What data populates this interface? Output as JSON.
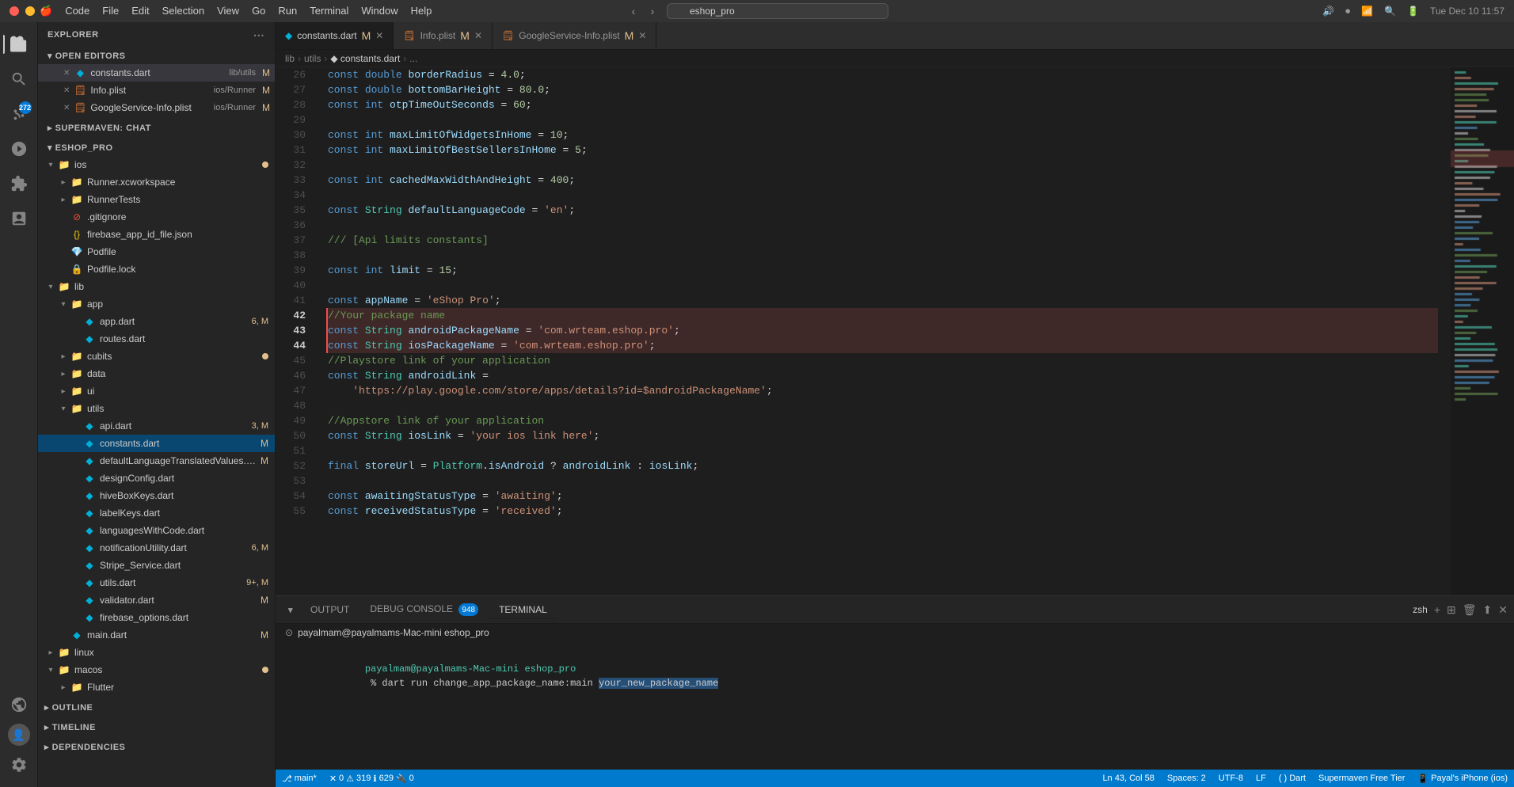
{
  "titlebar": {
    "menu_items": [
      "Code",
      "File",
      "Edit",
      "Selection",
      "View",
      "Go",
      "Run",
      "Terminal",
      "Window",
      "Help"
    ],
    "search_placeholder": "eshop_pro",
    "search_value": "eshop_pro",
    "time": "Tue Dec 10  11:57"
  },
  "tabs": [
    {
      "name": "constants.dart",
      "path": "lib/utils",
      "modified": true,
      "active": true
    },
    {
      "name": "Info.plist",
      "path": "ios/Runner",
      "modified": true,
      "active": false
    },
    {
      "name": "GoogleService-Info.plist",
      "path": "ios/Runner",
      "modified": true,
      "active": false
    }
  ],
  "breadcrumb": [
    "lib",
    ">",
    "utils",
    ">",
    "constants.dart",
    ">",
    "..."
  ],
  "sidebar": {
    "sections": [
      {
        "id": "open-editors",
        "label": "OPEN EDITORS",
        "items": [
          {
            "icon": "dart",
            "name": "constants.dart",
            "path": "lib/utils",
            "modified": true,
            "active": true,
            "level": 1
          },
          {
            "icon": "plist",
            "name": "Info.plist",
            "path": "ios/Runner",
            "modified": true,
            "level": 1
          },
          {
            "icon": "plist",
            "name": "GoogleService-Info.plist",
            "path": "ios/Runner",
            "modified": true,
            "level": 1
          }
        ]
      },
      {
        "id": "supermaven-chat",
        "label": "SUPERMAVEN: CHAT",
        "collapsed": true,
        "items": []
      },
      {
        "id": "eshop-pro",
        "label": "ESHOP_PRO",
        "items": [
          {
            "icon": "folder",
            "name": "ios",
            "level": 0,
            "expanded": true,
            "dot": true
          },
          {
            "icon": "folder",
            "name": "Runner.xcworkspace",
            "level": 1,
            "expanded": false
          },
          {
            "icon": "folder",
            "name": "RunnerTests",
            "level": 1,
            "expanded": false
          },
          {
            "icon": "git",
            "name": ".gitignore",
            "level": 1
          },
          {
            "icon": "json",
            "name": "firebase_app_id_file.json",
            "level": 1
          },
          {
            "icon": "ruby",
            "name": "Podfile",
            "level": 1
          },
          {
            "icon": "lock",
            "name": "Podfile.lock",
            "level": 1
          },
          {
            "icon": "folder",
            "name": "lib",
            "level": 0,
            "expanded": true
          },
          {
            "icon": "folder",
            "name": "app",
            "level": 1,
            "expanded": true
          },
          {
            "icon": "dart",
            "name": "app.dart",
            "level": 2,
            "badge": "6, M"
          },
          {
            "icon": "dart",
            "name": "routes.dart",
            "level": 2
          },
          {
            "icon": "folder",
            "name": "cubits",
            "level": 1,
            "dot": true
          },
          {
            "icon": "folder",
            "name": "data",
            "level": 1
          },
          {
            "icon": "folder",
            "name": "ui",
            "level": 1
          },
          {
            "icon": "folder",
            "name": "utils",
            "level": 1,
            "expanded": true
          },
          {
            "icon": "dart",
            "name": "api.dart",
            "level": 2,
            "badge": "3, M"
          },
          {
            "icon": "dart",
            "name": "constants.dart",
            "level": 2,
            "active": true,
            "modified_m": true
          },
          {
            "icon": "dart",
            "name": "defaultLanguageTranslatedValues.dart",
            "level": 2,
            "modified_m": true
          },
          {
            "icon": "dart",
            "name": "designConfig.dart",
            "level": 2
          },
          {
            "icon": "dart",
            "name": "hiveBoxKeys.dart",
            "level": 2
          },
          {
            "icon": "dart",
            "name": "labelKeys.dart",
            "level": 2
          },
          {
            "icon": "dart",
            "name": "languagesWithCode.dart",
            "level": 2
          },
          {
            "icon": "dart",
            "name": "notificationUtility.dart",
            "level": 2,
            "badge": "6, M"
          },
          {
            "icon": "dart",
            "name": "Stripe_Service.dart",
            "level": 2
          },
          {
            "icon": "dart",
            "name": "utils.dart",
            "level": 2,
            "badge": "9+, M"
          },
          {
            "icon": "dart",
            "name": "validator.dart",
            "level": 2,
            "modified_m": true
          },
          {
            "icon": "dart",
            "name": "firebase_options.dart",
            "level": 2
          },
          {
            "icon": "dart",
            "name": "main.dart",
            "level": 1,
            "modified_m": true
          },
          {
            "icon": "folder",
            "name": "linux",
            "level": 0,
            "expanded": false
          },
          {
            "icon": "folder",
            "name": "macos",
            "level": 0,
            "expanded": true,
            "dot": true
          },
          {
            "icon": "folder",
            "name": "Flutter",
            "level": 1
          },
          {
            "icon": "folder",
            "name": "OUTLINE",
            "level": 0,
            "collapsed_section": true
          },
          {
            "icon": "folder",
            "name": "TIMELINE",
            "level": 0,
            "collapsed_section": true
          },
          {
            "icon": "folder",
            "name": "DEPENDENCIES",
            "level": 0,
            "collapsed_section": true
          }
        ]
      }
    ]
  },
  "code": {
    "lines": [
      {
        "n": 26,
        "text": "const double borderRadius = 4.0;"
      },
      {
        "n": 27,
        "text": "const double bottomBarHeight = 80.0;"
      },
      {
        "n": 28,
        "text": "const int otpTimeOutSeconds = 60;"
      },
      {
        "n": 29,
        "text": ""
      },
      {
        "n": 30,
        "text": "const int maxLimitOfWidgetsInHome = 10;"
      },
      {
        "n": 31,
        "text": "const int maxLimitOfBestSellersInHome = 5;"
      },
      {
        "n": 32,
        "text": ""
      },
      {
        "n": 33,
        "text": "const int cachedMaxWidthAndHeight = 400;"
      },
      {
        "n": 34,
        "text": ""
      },
      {
        "n": 35,
        "text": "const String defaultLanguageCode = 'en';"
      },
      {
        "n": 36,
        "text": ""
      },
      {
        "n": 37,
        "text": "/// [Api limits constants]"
      },
      {
        "n": 38,
        "text": ""
      },
      {
        "n": 39,
        "text": "const int limit = 15;"
      },
      {
        "n": 40,
        "text": ""
      },
      {
        "n": 41,
        "text": "const appName = 'eShop Pro';"
      },
      {
        "n": 42,
        "text": "//Your package name",
        "highlight": true
      },
      {
        "n": 43,
        "text": "const String androidPackageName = 'com.wrteam.eshop.pro';",
        "highlight": true
      },
      {
        "n": 44,
        "text": "const String iosPackageName = 'com.wrteam.eshop.pro';",
        "highlight": true
      },
      {
        "n": 45,
        "text": "//Playstore link of your application"
      },
      {
        "n": 46,
        "text": "const String androidLink ="
      },
      {
        "n": 47,
        "text": "    'https://play.google.com/store/apps/details?id=$androidPackageName';"
      },
      {
        "n": 48,
        "text": ""
      },
      {
        "n": 49,
        "text": "//Appstore link of your application"
      },
      {
        "n": 50,
        "text": "const String iosLink = 'your ios link here';"
      },
      {
        "n": 51,
        "text": ""
      },
      {
        "n": 52,
        "text": "final storeUrl = Platform.isAndroid ? androidLink : iosLink;"
      },
      {
        "n": 53,
        "text": ""
      },
      {
        "n": 54,
        "text": "const awaitingStatusType = 'awaiting';"
      },
      {
        "n": 55,
        "text": "const receivedStatusType = 'received';"
      }
    ]
  },
  "panel": {
    "tabs": [
      {
        "label": "OUTPUT",
        "active": false
      },
      {
        "label": "DEBUG CONSOLE",
        "active": false
      },
      {
        "label": "948",
        "badge": true,
        "active": false
      },
      {
        "label": "TERMINAL",
        "active": true
      }
    ],
    "terminal_label": "zsh",
    "terminal_prompt": "payalmam@payalmams-Mac-mini eshop_pro %",
    "terminal_command": "dart run change_app_package_name:main ",
    "terminal_highlight": "your_new_package_name"
  },
  "statusbar": {
    "branch": "main*",
    "errors": "0",
    "warnings": "319",
    "info": "629",
    "ports": "0",
    "cursor": "Ln 43, Col 58",
    "spaces": "Spaces: 2",
    "encoding": "UTF-8",
    "line_ending": "LF",
    "language": "Dart",
    "plugin": "Supermaven Free Tier",
    "device": "Payal's iPhone (ios)"
  }
}
